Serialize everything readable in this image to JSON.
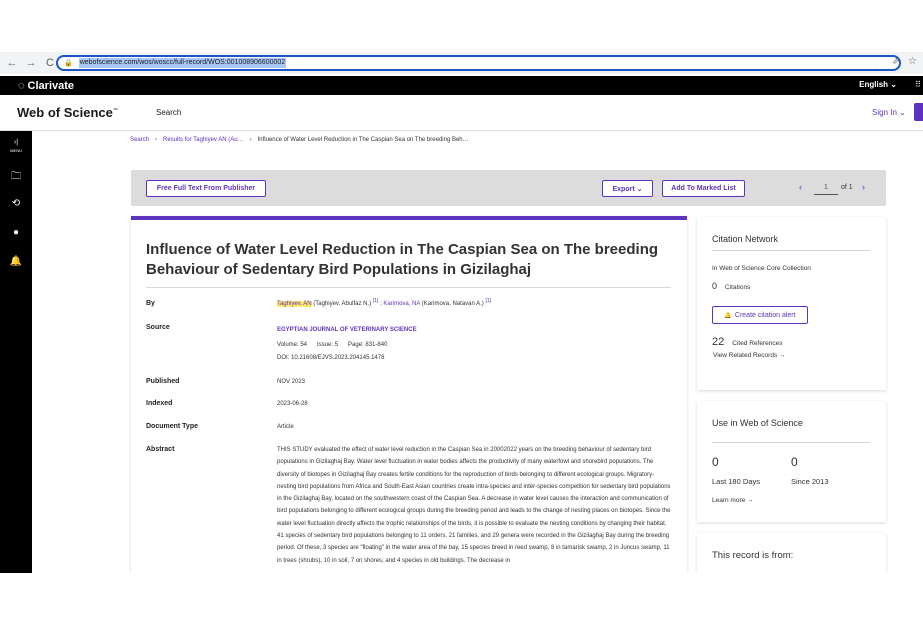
{
  "browser": {
    "url": "webofscience.com/wos/woscc/full-record/WOS:001008906600002",
    "back": "←",
    "forward": "→",
    "reload": "C",
    "lock": "🔒",
    "share": "⇗",
    "star": "☆"
  },
  "clarivate": {
    "logo": "Clarivate",
    "mark": "◌",
    "language": "English ⌄",
    "apps": "⠿"
  },
  "header": {
    "logo": "Web of Science",
    "logo_tm": "™",
    "search": "Search",
    "sign_in": "Sign In ⌄"
  },
  "rail": {
    "menu_arrow": "›|",
    "menu_label": "MENU",
    "folder_icon": "🗀",
    "history_icon": "⟲",
    "user_icon": "●",
    "bell_icon": "🔔"
  },
  "breadcrumb": {
    "items": [
      "Search",
      "Results for Taghiyev AN (Au…",
      "Influence of Water Level Reduction in The Caspian Sea on The breeding Beh…"
    ],
    "sep": "›"
  },
  "actions": {
    "free_full_text": "Free Full Text From Publisher",
    "export": "Export ⌄",
    "add_marked": "Add To Marked List",
    "prev": "‹",
    "page": "1",
    "of": "of 1",
    "next": "›"
  },
  "record": {
    "title": "Influence of Water Level Reduction in The Caspian Sea on The breeding Behaviour of Sedentary Bird Populations in Gizilaghaj",
    "labels": {
      "by": "By",
      "source": "Source",
      "published": "Published",
      "indexed": "Indexed",
      "doc_type": "Document Type",
      "abstract": "Abstract"
    },
    "author1": "Taghiyev, AN",
    "author1_full": " (Taghiyev, Abulfaz N.)",
    "ref1": "[1]",
    "separator": " ; ",
    "author2": "Karimova, NA",
    "author2_full": " (Karimova, Natavan A.)",
    "ref2": "[1]",
    "journal": "EGYPTIAN JOURNAL OF VETERINARY SCIENCE",
    "volume_line": "Volume: 54      Issue: 5      Page: 831-840",
    "doi": "DOI: 10.21608/EJVS.2023.204145.1478",
    "published": "NOV 2023",
    "indexed": "2023-06-28",
    "doc_type": "Article",
    "abstract": "THIS STUDY evaluated the effect of water level reduction in the Caspian Sea in 20002022 years on the breeding behaviour of sedentary bird populations in Gizilaghaj Bay. Water level fluctuation in water bodies affects the productivity of many waterfowl and shorebird populations. The diversity of biotopes in Gizilaghaj Bay creates fertile conditions for the reproduction of birds belonging to different ecological groups. Migratory-nesting bird populations from Africa and South-East Asian countries create intra-species and inter-species competition for sedentary bird populations in the Gizilaghaj Bay, located on the southwestern coast of the Caspian Sea. A decrease in water level causes the interaction and communication of bird populations belonging to different ecological groups during the breeding period and leads to the change of nesting places on biotopes. Since the water level fluctuation directly affects the trophic relationships of the birds, it is possible to evaluate the nesting conditions by changing their habitat. 41 species of sedentary bird populations belonging to 11 orders, 21 families, and 29 genera were recorded in the Gizilaghaj Bay during the breeding period. Of these, 3 species are \"floating\" in the water area of the bay, 15 species breed in reed swamp, 8 in tamarisk swamp, 2 in Juncus swamp, 11 in trees (shrubs), 10 in soil, 7 on shores, and 4 species in old buildings. The decrease in"
  },
  "citation_network": {
    "title": "Citation Network",
    "collection": "In Web of Science Core Collection",
    "citations_count": "0",
    "citations_label": "Citations",
    "alert_icon": "🔔",
    "alert_label": "Create citation alert",
    "cited_refs_count": "22",
    "cited_refs_label": "Cited References",
    "view_related": "View Related Records →"
  },
  "use_in_wos": {
    "title": "Use in Web of Science",
    "count_180": "0",
    "label_180": "Last 180 Days",
    "count_2013": "0",
    "label_2013": "Since 2013",
    "learn_more": "Learn more →"
  },
  "record_from": {
    "title": "This record is from:"
  },
  "colors": {
    "accent": "#5e33bf",
    "highlight": "#ffe96b",
    "rail": "#000000",
    "action_bar": "#dcdcdc"
  }
}
